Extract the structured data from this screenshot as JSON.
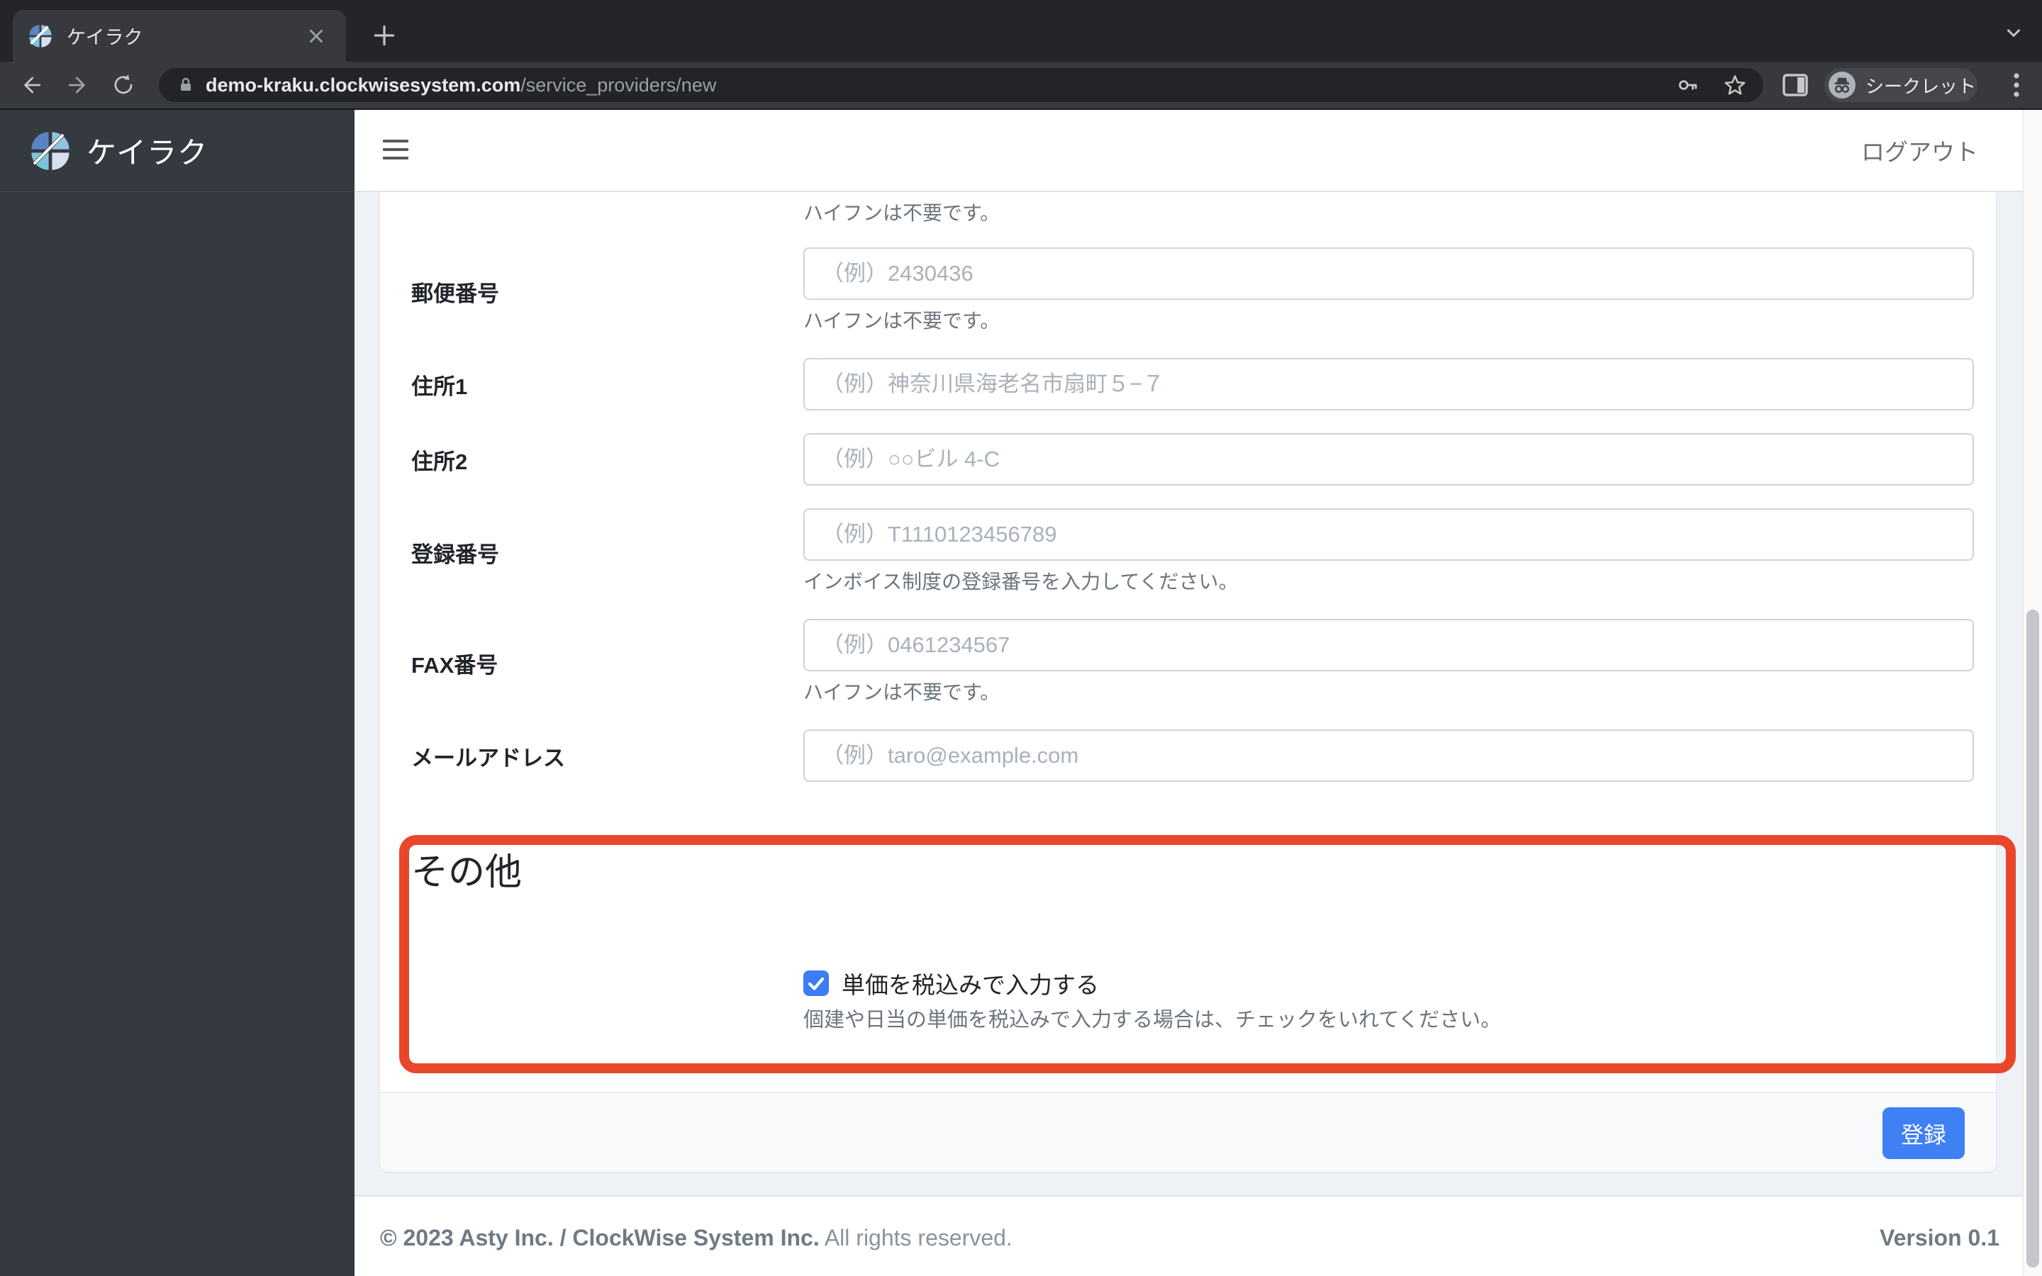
{
  "browser": {
    "tab_title": "ケイラク",
    "url_host": "demo-kraku.clockwisesystem.com",
    "url_path": "/service_providers/new",
    "incognito_label": "シークレット"
  },
  "app": {
    "brand": "ケイラク",
    "logout_label": "ログアウト"
  },
  "form": {
    "top_helper": "ハイフンは不要です。",
    "rows": [
      {
        "label": "郵便番号",
        "placeholder": "（例）2430436",
        "helper": "ハイフンは不要です。"
      },
      {
        "label": "住所1",
        "placeholder": "（例）神奈川県海老名市扇町５−７",
        "helper": ""
      },
      {
        "label": "住所2",
        "placeholder": "（例）○○ビル 4-C",
        "helper": ""
      },
      {
        "label": "登録番号",
        "placeholder": "（例）T1110123456789",
        "helper": "インボイス制度の登録番号を入力してください。"
      },
      {
        "label": "FAX番号",
        "placeholder": "（例）0461234567",
        "helper": "ハイフンは不要です。"
      },
      {
        "label": "メールアドレス",
        "placeholder": "（例）taro@example.com",
        "helper": ""
      }
    ]
  },
  "other_section": {
    "title": "その他",
    "checkbox_label": "単価を税込みで入力する",
    "checkbox_checked": true,
    "checkbox_helper": "個建や日当の単価を税込みで入力する場合は、チェックをいれてください。"
  },
  "actions": {
    "submit_label": "登録"
  },
  "page_footer": {
    "copyright_strong": "© 2023 Asty Inc. / ClockWise System Inc.",
    "copyright_rest": "All rights reserved.",
    "version": "Version 0.1"
  },
  "colors": {
    "annotation_red": "#e8472b",
    "checkbox_blue": "#3b7cf7",
    "button_blue": "#4080f5",
    "sidebar_dark": "#343a40"
  }
}
